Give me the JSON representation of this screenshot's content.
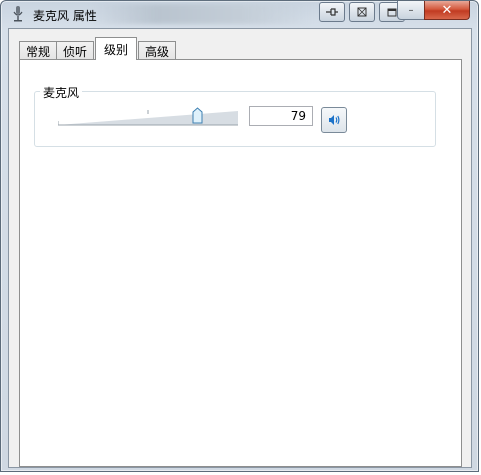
{
  "window": {
    "title": "麦克风 属性",
    "caption_buttons": {
      "minimize": "–",
      "maximize": "□",
      "close": "✕"
    }
  },
  "tabs": [
    {
      "label": "常规",
      "active": false
    },
    {
      "label": "侦听",
      "active": false
    },
    {
      "label": "级别",
      "active": true
    },
    {
      "label": "高级",
      "active": false
    }
  ],
  "levels": {
    "group_label": "麦克风",
    "volume_value": "79",
    "volume_fraction": 0.79,
    "speaker_icon": "speaker-icon"
  }
}
